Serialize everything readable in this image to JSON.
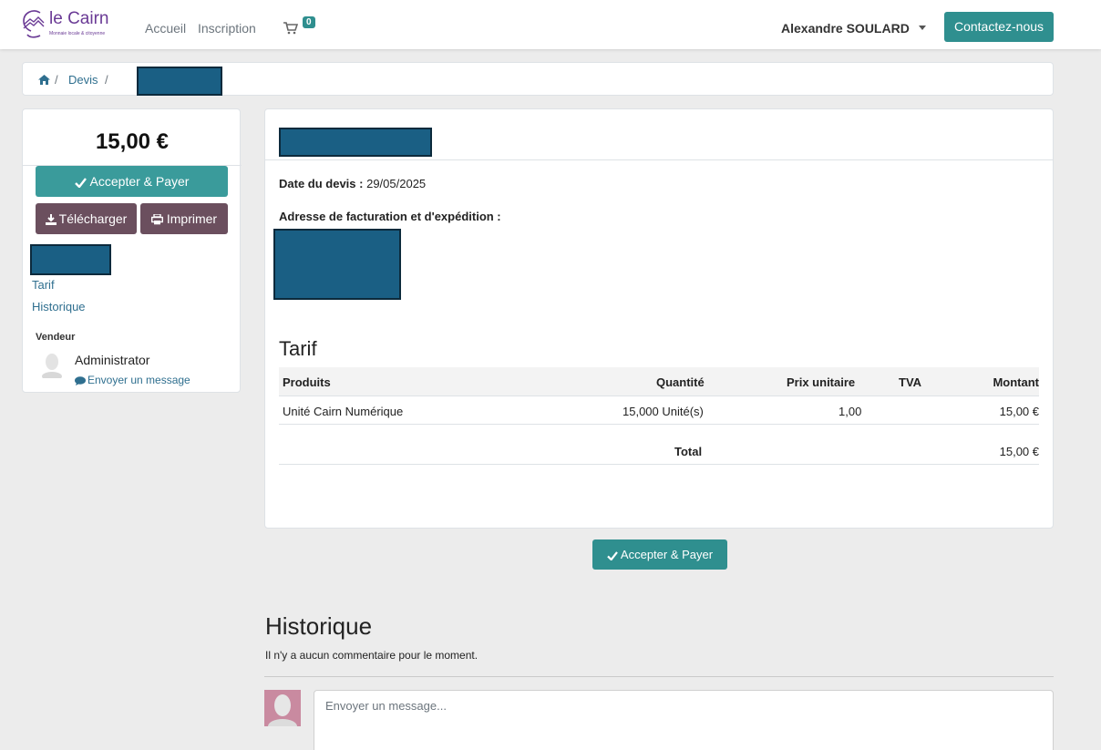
{
  "header": {
    "logo_title": "le Cairn",
    "logo_subtitle": "Monnaie locale & citoyenne",
    "nav": [
      "Accueil",
      "Inscription"
    ],
    "cart_count": "0",
    "user_name": "Alexandre SOULARD",
    "contact_label": "Contactez-nous",
    "accent_color": "#2f8f8f"
  },
  "breadcrumb": {
    "home_icon": "home-icon",
    "items": [
      "Devis"
    ]
  },
  "sidebar": {
    "price": "15,00 €",
    "accept_label": "Accepter & Payer",
    "download_label": "Télécharger",
    "print_label": "Imprimer",
    "links": [
      "Tarif",
      "Historique"
    ],
    "vendor_title": "Vendeur",
    "vendor_name": "Administrator",
    "send_message_label": "Envoyer un message"
  },
  "quote": {
    "date_label": "Date du devis :",
    "date_value": "29/05/2025",
    "address_label": "Adresse de facturation et d'expédition :",
    "section_title": "Tarif",
    "columns": [
      "Produits",
      "Quantité",
      "Prix unitaire",
      "TVA",
      "Montant"
    ],
    "rows": [
      {
        "product": "Unité Cairn Numérique",
        "quantity": "15,000 Unité(s)",
        "unit_price": "1,00",
        "tva": "",
        "amount": "15,00 €"
      }
    ],
    "total_label": "Total",
    "total_value": "15,00 €"
  },
  "actions": {
    "accept_label": "Accepter & Payer"
  },
  "history": {
    "title": "Historique",
    "empty_text": "Il n'y a aucun commentaire pour le moment.",
    "message_placeholder": "Envoyer un message..."
  }
}
